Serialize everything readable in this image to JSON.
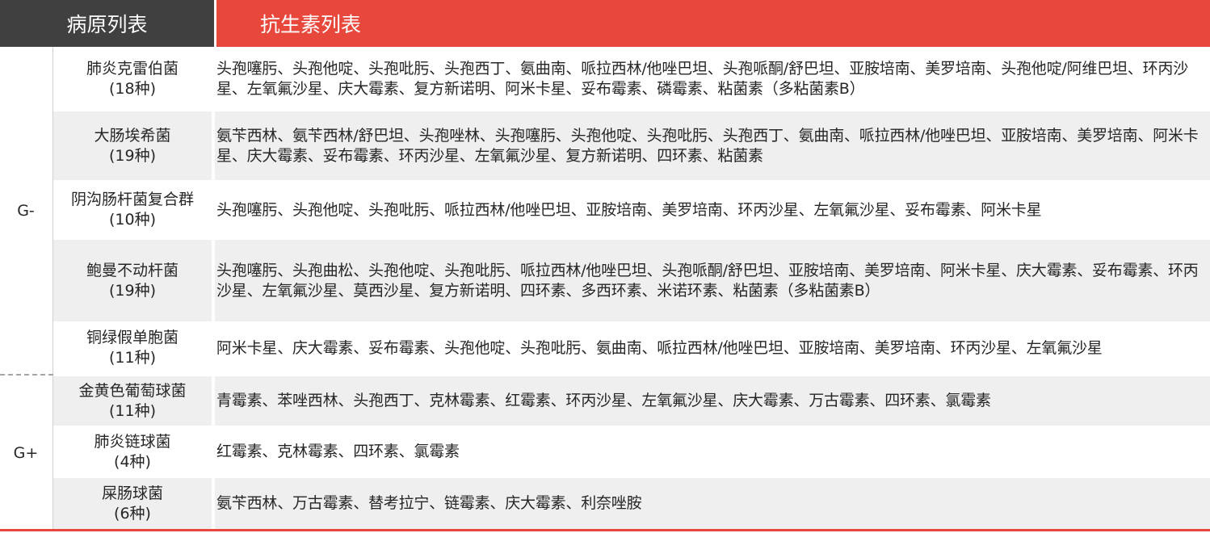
{
  "header": {
    "pathogen_list": "病原列表",
    "antibiotic_list": "抗生素列表"
  },
  "groups": {
    "gram_negative": "G-",
    "gram_positive": "G+"
  },
  "rows": [
    {
      "name": "肺炎克雷伯菌",
      "count": "(18种)",
      "antibiotics": "头孢噻肟、头孢他啶、头孢吡肟、头孢西丁、氨曲南、哌拉西林/他唑巴坦、头孢哌酮/舒巴坦、亚胺培南、美罗培南、头孢他啶/阿维巴坦、环丙沙星、左氧氟沙星、庆大霉素、复方新诺明、阿米卡星、妥布霉素、磷霉素、粘菌素（多粘菌素B）"
    },
    {
      "name": "大肠埃希菌",
      "count": "(19种)",
      "antibiotics": "氨苄西林、氨苄西林/舒巴坦、头孢唑林、头孢噻肟、头孢他啶、头孢吡肟、头孢西丁、氨曲南、哌拉西林/他唑巴坦、亚胺培南、美罗培南、阿米卡星、庆大霉素、妥布霉素、环丙沙星、左氧氟沙星、复方新诺明、四环素、粘菌素"
    },
    {
      "name": "阴沟肠杆菌复合群",
      "count": "(10种)",
      "antibiotics": "头孢噻肟、头孢他啶、头孢吡肟、哌拉西林/他唑巴坦、亚胺培南、美罗培南、环丙沙星、左氧氟沙星、妥布霉素、阿米卡星"
    },
    {
      "name": "鲍曼不动杆菌",
      "count": "(19种)",
      "antibiotics": "头孢噻肟、头孢曲松、头孢他啶、头孢吡肟、哌拉西林/他唑巴坦、头孢哌酮/舒巴坦、亚胺培南、美罗培南、阿米卡星、庆大霉素、妥布霉素、环丙沙星、左氧氟沙星、莫西沙星、复方新诺明、四环素、多西环素、米诺环素、粘菌素（多粘菌素B）"
    },
    {
      "name": "铜绿假单胞菌",
      "count": "(11种)",
      "antibiotics": "阿米卡星、庆大霉素、妥布霉素、头孢他啶、头孢吡肟、氨曲南、哌拉西林/他唑巴坦、亚胺培南、美罗培南、环丙沙星、左氧氟沙星"
    },
    {
      "name": "金黄色葡萄球菌",
      "count": "(11种)",
      "antibiotics": "青霉素、苯唑西林、头孢西丁、克林霉素、红霉素、环丙沙星、左氧氟沙星、庆大霉素、万古霉素、四环素、氯霉素"
    },
    {
      "name": "肺炎链球菌",
      "count": "(4种)",
      "antibiotics": "红霉素、克林霉素、四环素、氯霉素"
    },
    {
      "name": "屎肠球菌",
      "count": "(6种)",
      "antibiotics": "氨苄西林、万古霉素、替考拉宁、链霉素、庆大霉素、利奈唑胺"
    }
  ]
}
